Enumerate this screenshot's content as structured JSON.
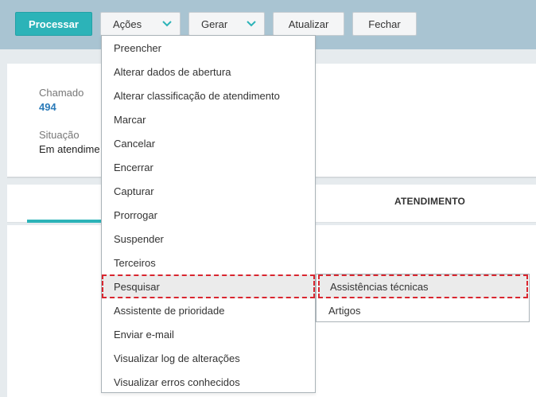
{
  "toolbar": {
    "processar": "Processar",
    "acoes": "Ações",
    "gerar": "Gerar",
    "atualizar": "Atualizar",
    "fechar": "Fechar",
    "primary_color": "#2cb3b8",
    "band_color": "#a9c4d2"
  },
  "details": {
    "chamado_label": "Chamado",
    "chamado_value": "494",
    "situacao_label": "Situação",
    "situacao_value": "Em atendime"
  },
  "tabs": {
    "atendimento": "ATENDIMENTO"
  },
  "acoes_menu": {
    "items": [
      "Preencher",
      "Alterar dados de abertura",
      "Alterar classificação de atendimento",
      "Marcar",
      "Cancelar",
      "Encerrar",
      "Capturar",
      "Prorrogar",
      "Suspender",
      "Terceiros",
      "Pesquisar",
      "Assistente de prioridade",
      "Enviar e-mail",
      "Visualizar log de alterações",
      "Visualizar erros conhecidos"
    ],
    "highlighted": "Pesquisar"
  },
  "pesquisar_submenu": {
    "items": [
      "Assistências técnicas",
      "Artigos"
    ],
    "highlighted": "Assistências técnicas"
  },
  "highlight_color": "#d9262f"
}
